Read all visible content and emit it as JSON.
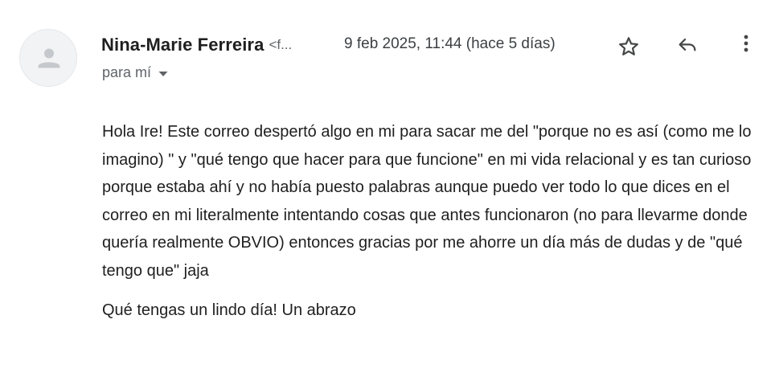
{
  "email": {
    "sender_name": "Nina-Marie Ferreira",
    "sender_email_truncated": "<f...",
    "timestamp": "9 feb 2025, 11:44 (hace 5 días)",
    "recipient_label": "para mí",
    "body_paragraph": "Hola Ire! Este correo despertó algo en mi para sacar me del \"porque no es así (como me lo imagino) \" y \"qué tengo que hacer para que funcione\" en mi vida relacional y es tan curioso porque estaba ahí y no había puesto palabras aunque puedo ver todo lo que dices en el correo en mi literalmente intentando cosas que antes funcionaron (no para llevarme donde quería realmente OBVIO) entonces gracias por me ahorre un día más de dudas y de \"qué tengo que\" jaja",
    "closing": "Qué tengas un lindo día! Un abrazo"
  },
  "icons": {
    "avatar": "person-placeholder-icon",
    "star": "star-outline-icon",
    "reply": "reply-arrow-icon",
    "more": "more-vertical-icon",
    "recipient_details": "caret-down-icon"
  },
  "colors": {
    "text_primary": "#1f1f1f",
    "text_secondary": "#5f6368",
    "avatar_bg": "#f1f3f4",
    "avatar_glyph": "#c5c8cc",
    "icon": "#444746"
  }
}
